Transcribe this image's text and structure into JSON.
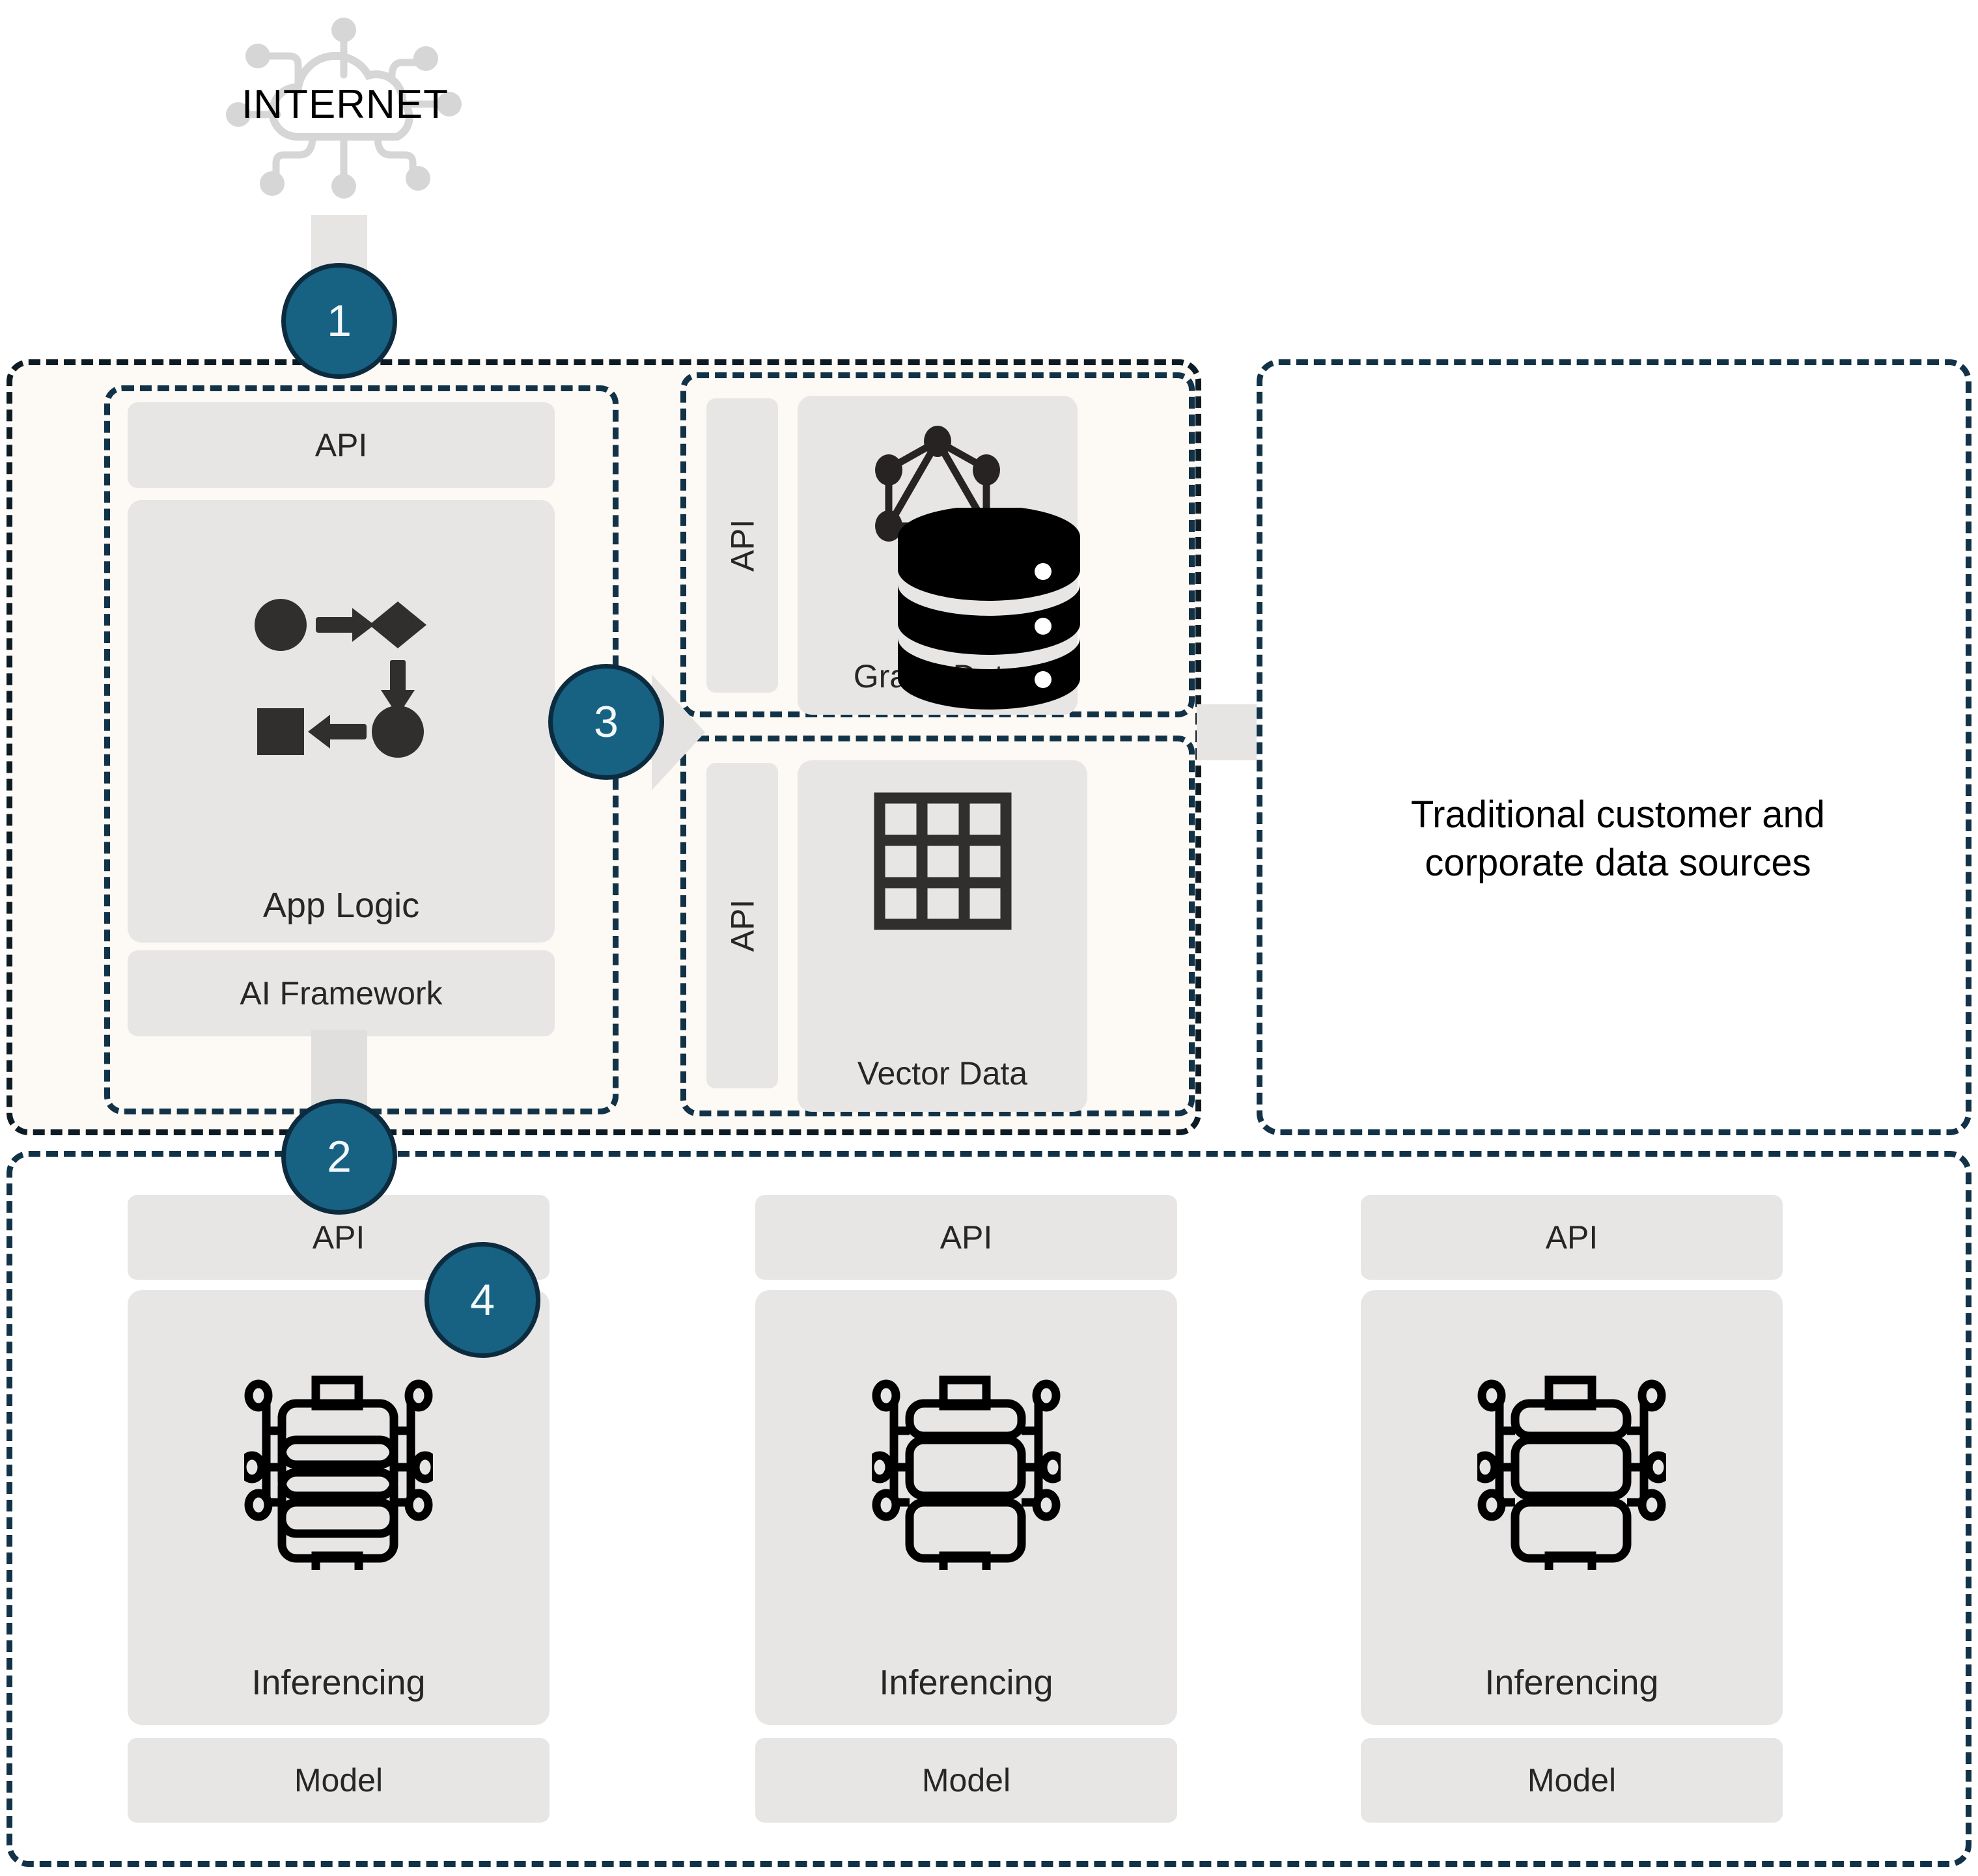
{
  "internet": {
    "label": "INTERNET",
    "icon": "cloud-network-icon"
  },
  "badges": [
    {
      "id": "badge-1",
      "number": "1"
    },
    {
      "id": "badge-2",
      "number": "2"
    },
    {
      "id": "badge-3",
      "number": "3"
    },
    {
      "id": "badge-4",
      "number": "4"
    }
  ],
  "application": {
    "api_label": "API",
    "app_logic_label": "App Logic",
    "app_logic_icon": "workflow-icon",
    "ai_framework_label": "AI Framework"
  },
  "data_stores": [
    {
      "api_label": "API",
      "title": "Graph Data",
      "icon": "graph-node-icon"
    },
    {
      "api_label": "API",
      "title": "Vector Data",
      "icon": "matrix-grid-icon"
    }
  ],
  "database_panel": {
    "icon": "database-cylinder-icon",
    "caption": "Traditional customer and corporate data sources"
  },
  "model_columns": [
    {
      "api_label": "API",
      "inferencing_label": "Inferencing",
      "model_label": "Model",
      "icon": "inference-chip-icon"
    },
    {
      "api_label": "API",
      "inferencing_label": "Inferencing",
      "model_label": "Model",
      "icon": "inference-chip-icon"
    },
    {
      "api_label": "API",
      "inferencing_label": "Inferencing",
      "model_label": "Model",
      "icon": "inference-chip-icon"
    }
  ],
  "colors": {
    "badge_fill": "#176183",
    "badge_border": "#0d2b3e",
    "container_border": "#123247",
    "outer_border": "#0d1b24",
    "panel_fill": "#e7e6e5",
    "tinted_background": "#fdf9f5",
    "arrow_fill": "#e6e5e4",
    "icon_dark": "#312f2d"
  }
}
